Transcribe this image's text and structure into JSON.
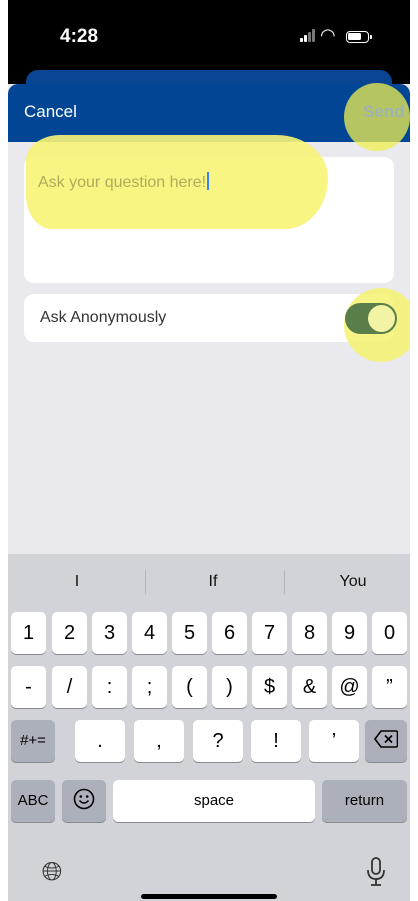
{
  "status_bar": {
    "time": "4:28"
  },
  "nav": {
    "cancel_label": "Cancel",
    "send_label": "Send"
  },
  "question": {
    "placeholder": "Ask your question here!",
    "value": ""
  },
  "anonymous": {
    "label": "Ask Anonymously",
    "enabled": true
  },
  "keyboard": {
    "suggestions": [
      "I",
      "If",
      "You"
    ],
    "row1": [
      "1",
      "2",
      "3",
      "4",
      "5",
      "6",
      "7",
      "8",
      "9",
      "0"
    ],
    "row2": [
      "-",
      "/",
      ":",
      ";",
      "(",
      ")",
      "$",
      "&",
      "@",
      "”"
    ],
    "row3_mode": "#+=",
    "row3": [
      ".",
      ",",
      "?",
      "!",
      "’"
    ],
    "abc_label": "ABC",
    "space_label": "space",
    "return_label": "return"
  },
  "colors": {
    "nav_bg": "#004694",
    "toggle_on": "#5a7e4a",
    "highlight": "#f5f26e"
  },
  "icons": [
    "signal-icon",
    "wifi-icon",
    "battery-icon",
    "delete-icon",
    "emoji-icon",
    "globe-icon",
    "mic-icon"
  ]
}
